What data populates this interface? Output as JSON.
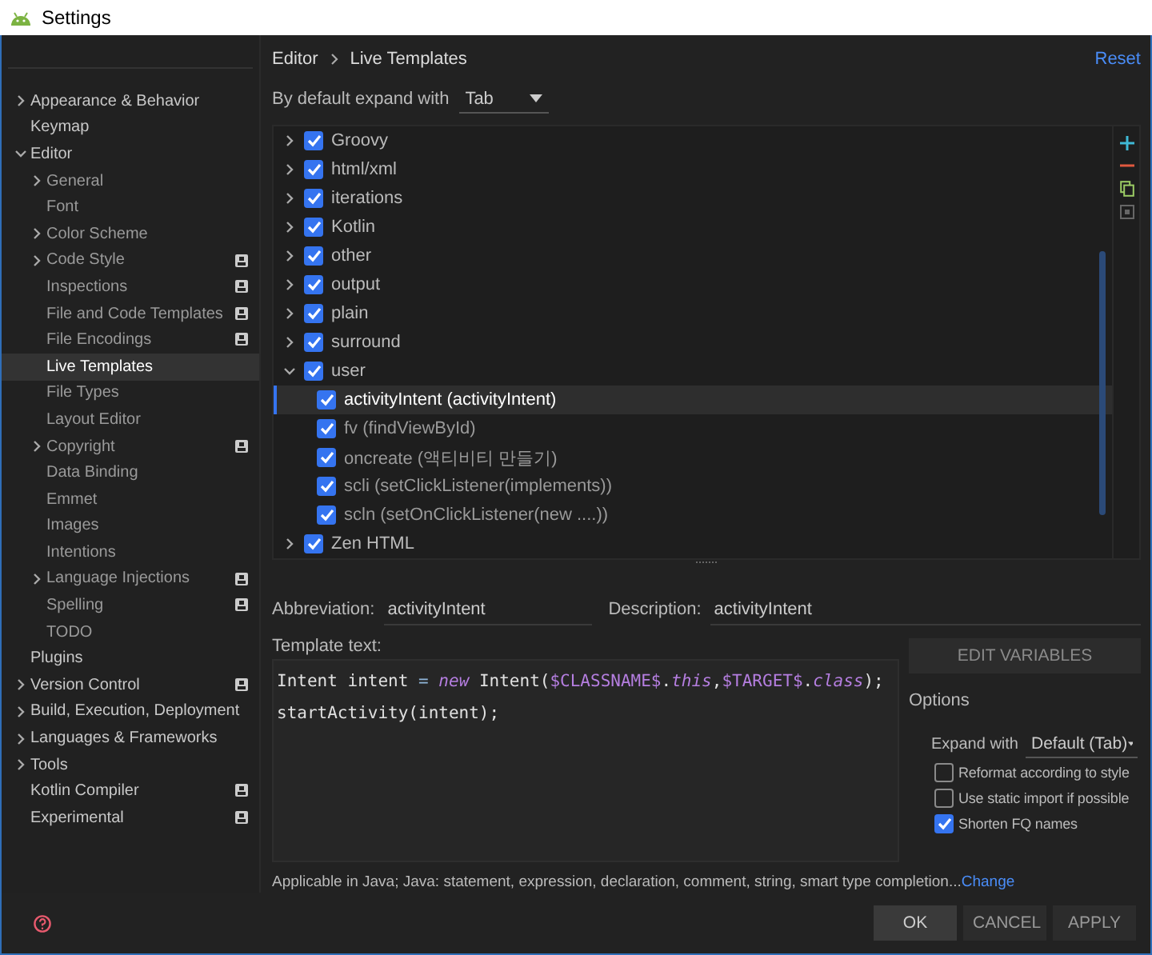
{
  "window": {
    "title": "Settings"
  },
  "sidebar": {
    "items": [
      {
        "label": "Appearance & Behavior",
        "kind": "group",
        "expanded": false,
        "project_icon": false,
        "selected": false
      },
      {
        "label": "Keymap",
        "kind": "leaf",
        "project_icon": false,
        "selected": false
      },
      {
        "label": "Editor",
        "kind": "group",
        "expanded": true,
        "project_icon": false,
        "selected": false,
        "children": [
          {
            "label": "General",
            "kind": "group",
            "expanded": false,
            "project_icon": false,
            "selected": false
          },
          {
            "label": "Font",
            "kind": "leaf",
            "project_icon": false,
            "selected": false
          },
          {
            "label": "Color Scheme",
            "kind": "group",
            "expanded": false,
            "project_icon": false,
            "selected": false
          },
          {
            "label": "Code Style",
            "kind": "group",
            "expanded": false,
            "project_icon": true,
            "selected": false
          },
          {
            "label": "Inspections",
            "kind": "leaf",
            "project_icon": true,
            "selected": false
          },
          {
            "label": "File and Code Templates",
            "kind": "leaf",
            "project_icon": true,
            "selected": false
          },
          {
            "label": "File Encodings",
            "kind": "leaf",
            "project_icon": true,
            "selected": false
          },
          {
            "label": "Live Templates",
            "kind": "leaf",
            "project_icon": false,
            "selected": true
          },
          {
            "label": "File Types",
            "kind": "leaf",
            "project_icon": false,
            "selected": false
          },
          {
            "label": "Layout Editor",
            "kind": "leaf",
            "project_icon": false,
            "selected": false
          },
          {
            "label": "Copyright",
            "kind": "group",
            "expanded": false,
            "project_icon": true,
            "selected": false
          },
          {
            "label": "Data Binding",
            "kind": "leaf",
            "project_icon": false,
            "selected": false
          },
          {
            "label": "Emmet",
            "kind": "leaf",
            "project_icon": false,
            "selected": false
          },
          {
            "label": "Images",
            "kind": "leaf",
            "project_icon": false,
            "selected": false
          },
          {
            "label": "Intentions",
            "kind": "leaf",
            "project_icon": false,
            "selected": false
          },
          {
            "label": "Language Injections",
            "kind": "group",
            "expanded": false,
            "project_icon": true,
            "selected": false
          },
          {
            "label": "Spelling",
            "kind": "leaf",
            "project_icon": true,
            "selected": false
          },
          {
            "label": "TODO",
            "kind": "leaf",
            "project_icon": false,
            "selected": false
          }
        ]
      },
      {
        "label": "Plugins",
        "kind": "leaf",
        "project_icon": false,
        "selected": false
      },
      {
        "label": "Version Control",
        "kind": "group",
        "expanded": false,
        "project_icon": true,
        "selected": false
      },
      {
        "label": "Build, Execution, Deployment",
        "kind": "group",
        "expanded": false,
        "project_icon": false,
        "selected": false
      },
      {
        "label": "Languages & Frameworks",
        "kind": "group",
        "expanded": false,
        "project_icon": false,
        "selected": false
      },
      {
        "label": "Tools",
        "kind": "group",
        "expanded": false,
        "project_icon": false,
        "selected": false
      },
      {
        "label": "Kotlin Compiler",
        "kind": "leaf",
        "project_icon": true,
        "selected": false
      },
      {
        "label": "Experimental",
        "kind": "leaf",
        "project_icon": true,
        "selected": false
      }
    ]
  },
  "breadcrumb": [
    "Editor",
    "Live Templates"
  ],
  "reset": "Reset",
  "expand_default": {
    "label": "By default expand with",
    "value": "Tab"
  },
  "templates": [
    {
      "name": "Groovy",
      "checked": true,
      "expanded": false
    },
    {
      "name": "html/xml",
      "checked": true,
      "expanded": false
    },
    {
      "name": "iterations",
      "checked": true,
      "expanded": false
    },
    {
      "name": "Kotlin",
      "checked": true,
      "expanded": false
    },
    {
      "name": "other",
      "checked": true,
      "expanded": false
    },
    {
      "name": "output",
      "checked": true,
      "expanded": false
    },
    {
      "name": "plain",
      "checked": true,
      "expanded": false
    },
    {
      "name": "surround",
      "checked": true,
      "expanded": false
    },
    {
      "name": "user",
      "checked": true,
      "expanded": true,
      "children": [
        {
          "name": "activityIntent (activityIntent)",
          "checked": true,
          "selected": true
        },
        {
          "name": "fv (findViewById)",
          "checked": true,
          "selected": false
        },
        {
          "name": "oncreate (액티비티 만들기)",
          "checked": true,
          "selected": false
        },
        {
          "name": "scli (setClickListener(implements))",
          "checked": true,
          "selected": false
        },
        {
          "name": "scln (setOnClickListener(new ....))",
          "checked": true,
          "selected": false
        }
      ]
    },
    {
      "name": "Zen HTML",
      "checked": true,
      "expanded": false
    }
  ],
  "abbreviation": {
    "label": "Abbreviation:",
    "value": "activityIntent"
  },
  "description": {
    "label": "Description:",
    "value": "activityIntent"
  },
  "template_text": {
    "label": "Template text:",
    "lines": [
      [
        {
          "kind": "plain",
          "text": "Intent intent "
        },
        {
          "kind": "operator",
          "text": "= "
        },
        {
          "kind": "keyword",
          "text": "new"
        },
        {
          "kind": "plain",
          "text": " Intent("
        },
        {
          "kind": "variable",
          "text": "$CLASSNAME$"
        },
        {
          "kind": "plain",
          "text": "."
        },
        {
          "kind": "keyword",
          "text": "this"
        },
        {
          "kind": "plain",
          "text": ","
        },
        {
          "kind": "variable",
          "text": "$TARGET$"
        },
        {
          "kind": "plain",
          "text": "."
        },
        {
          "kind": "keyword",
          "text": "class"
        },
        {
          "kind": "plain",
          "text": ");"
        }
      ],
      [
        {
          "kind": "plain",
          "text": "startActivity(intent);"
        }
      ]
    ]
  },
  "edit_variables": "EDIT VARIABLES",
  "options": {
    "title": "Options",
    "expand_with": {
      "label": "Expand with",
      "value": "Default (Tab)"
    },
    "checkboxes": [
      {
        "label": "Reformat according to style",
        "checked": false
      },
      {
        "label": "Use static import if possible",
        "checked": false
      },
      {
        "label": "Shorten FQ names",
        "checked": true
      }
    ]
  },
  "applicable": {
    "text": "Applicable in Java; Java: statement, expression, declaration, comment, string, smart type completion...",
    "link": "Change"
  },
  "buttons": [
    {
      "label": "OK",
      "default": true
    },
    {
      "label": "CANCEL",
      "default": false
    },
    {
      "label": "APPLY",
      "default": false
    }
  ]
}
